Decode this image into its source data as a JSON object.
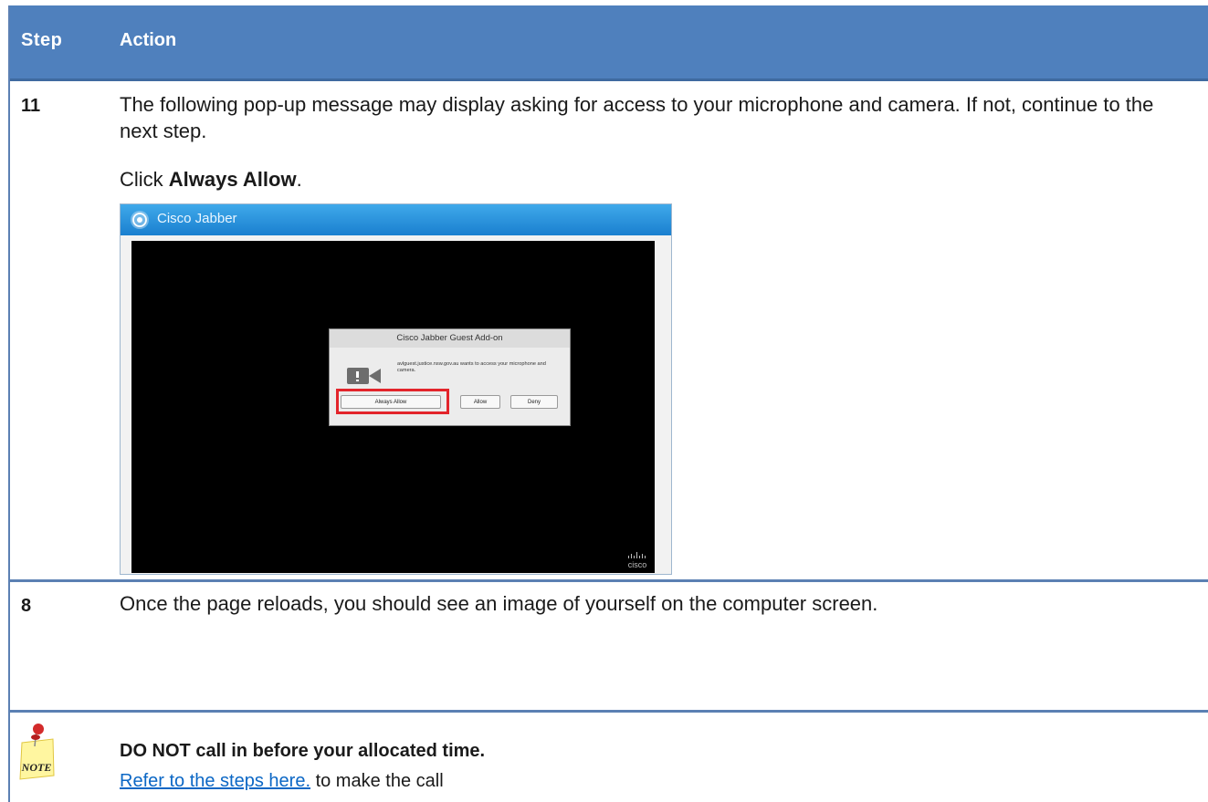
{
  "table": {
    "header": {
      "step": "Step",
      "action": "Action"
    },
    "rows": [
      {
        "step": "11",
        "text1": "The following pop-up message may display asking for access to your microphone and camera. If not, continue to the next step.",
        "click_prefix": "Click ",
        "click_bold": "Always Allow",
        "click_suffix": "."
      },
      {
        "step": "8",
        "text1": "Once the page reloads, you should see an image of yourself on the computer screen."
      }
    ]
  },
  "screenshot": {
    "window_title": "Cisco Jabber",
    "dialog_title": "Cisco Jabber Guest Add-on",
    "dialog_message": "avlguest.justice.nsw.gov.au wants to access your microphone and camera.",
    "buttons": {
      "always_allow": "Always Allow",
      "allow": "Allow",
      "deny": "Deny"
    },
    "cisco_logo_text": "cisco",
    "highlight_color": "#e3242b"
  },
  "note": {
    "icon_label": "NOTE",
    "heading": "DO NOT call in before your allocated time.",
    "link_text": "Refer to the steps here.",
    "after_link": " to make the call"
  },
  "colors": {
    "header_bg": "#4f80bd",
    "rule": "#5b80b3",
    "link": "#0b67c5"
  }
}
